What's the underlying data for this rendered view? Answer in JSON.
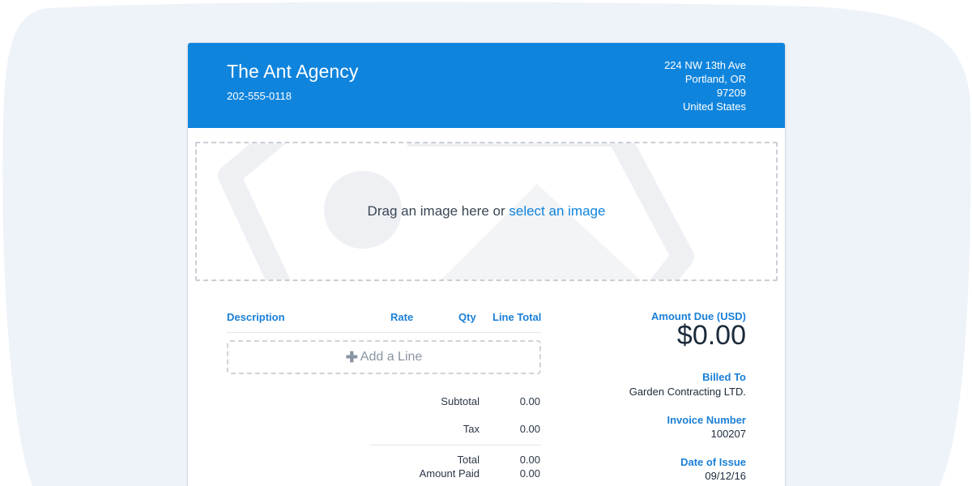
{
  "company": {
    "name": "The Ant Agency",
    "phone": "202-555-0118",
    "address": [
      "224 NW 13th Ave",
      "Portland, OR",
      "97209",
      "United States"
    ]
  },
  "dropzone": {
    "prefix": "Drag an image here or ",
    "link": "select an image"
  },
  "table": {
    "columns": [
      "Description",
      "Rate",
      "Qty",
      "Line Total"
    ],
    "add_line_label": "Add a Line",
    "add_line_icon": "plus-icon"
  },
  "summary": {
    "subtotal_label": "Subtotal",
    "subtotal_value": "0.00",
    "tax_label": "Tax",
    "tax_value": "0.00",
    "total_label": "Total",
    "total_value": "0.00",
    "amount_paid_label": "Amount Paid",
    "amount_paid_value": "0.00"
  },
  "details": {
    "amount_due_label": "Amount Due (USD)",
    "amount_due_value": "$0.00",
    "billed_to_label": "Billed To",
    "billed_to_value": "Garden Contracting LTD.",
    "invoice_number_label": "Invoice Number",
    "invoice_number_value": "100207",
    "date_of_issue_label": "Date of Issue",
    "date_of_issue_value": "09/12/16"
  },
  "colors": {
    "header_bg": "#0f84dd",
    "accent": "#1a7fd6",
    "background_blob": "#eef3f9"
  }
}
